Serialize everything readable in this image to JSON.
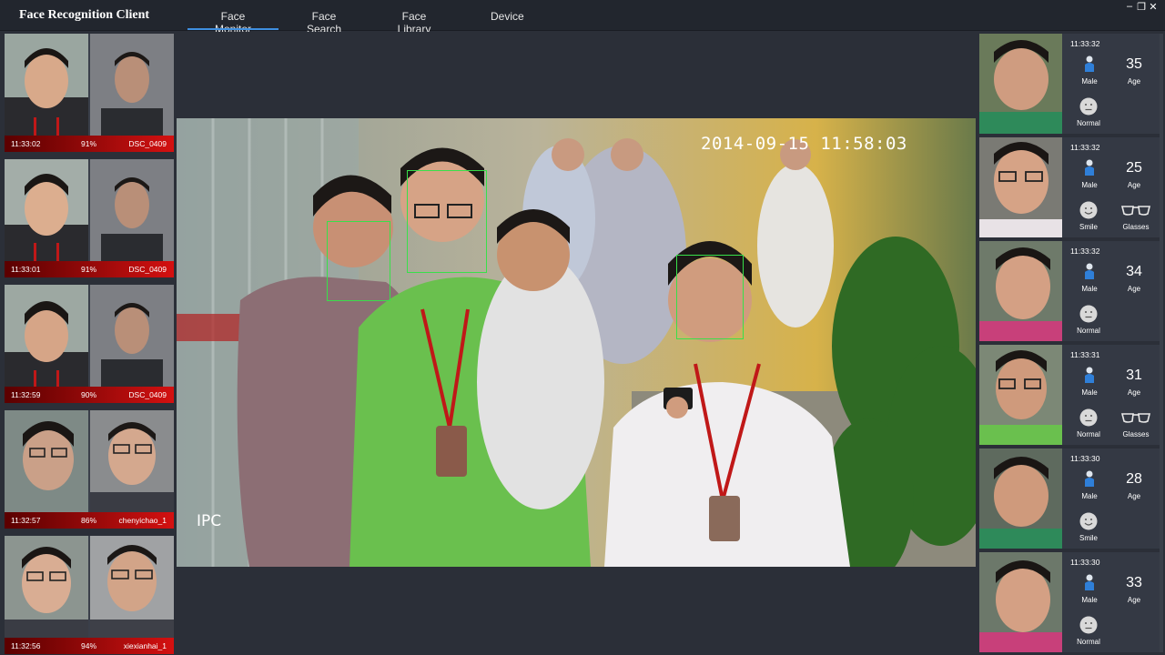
{
  "app": {
    "title": "Face Recognition Client"
  },
  "tabs": [
    {
      "label": "Face Monitor",
      "active": true
    },
    {
      "label": "Face Search",
      "active": false
    },
    {
      "label": "Face Library",
      "active": false
    },
    {
      "label": "Device",
      "active": false
    }
  ],
  "window_controls": {
    "minimize": "–",
    "restore": "❐",
    "close": "✕"
  },
  "matches": [
    {
      "time": "11:33:02",
      "score": "91%",
      "score_fraction": 0.91,
      "name": "DSC_0409"
    },
    {
      "time": "11:33:01",
      "score": "91%",
      "score_fraction": 0.91,
      "name": "DSC_0409"
    },
    {
      "time": "11:32:59",
      "score": "90%",
      "score_fraction": 0.9,
      "name": "DSC_0409"
    },
    {
      "time": "11:32:57",
      "score": "86%",
      "score_fraction": 0.86,
      "name": "chenyichao_1"
    },
    {
      "time": "11:32:56",
      "score": "94%",
      "score_fraction": 0.94,
      "name": "xiexianhai_1"
    }
  ],
  "video": {
    "timestamp": "2014-09-15 11:58:03",
    "camera_label": "IPC"
  },
  "detections": [
    {
      "time": "11:33:32",
      "gender": "Male",
      "age": "35",
      "age_label": "Age",
      "expression": "Normal",
      "glasses": ""
    },
    {
      "time": "11:33:32",
      "gender": "Male",
      "age": "25",
      "age_label": "Age",
      "expression": "Smile",
      "glasses": "Glasses"
    },
    {
      "time": "11:33:32",
      "gender": "Male",
      "age": "34",
      "age_label": "Age",
      "expression": "Normal",
      "glasses": ""
    },
    {
      "time": "11:33:31",
      "gender": "Male",
      "age": "31",
      "age_label": "Age",
      "expression": "Normal",
      "glasses": "Glasses"
    },
    {
      "time": "11:33:30",
      "gender": "Male",
      "age": "28",
      "age_label": "Age",
      "expression": "Smile",
      "glasses": ""
    },
    {
      "time": "11:33:30",
      "gender": "Male",
      "age": "33",
      "age_label": "Age",
      "expression": "Normal",
      "glasses": ""
    }
  ],
  "colors": {
    "accent": "#3f8fe0",
    "match_bar": "#d41010",
    "face_box": "#38e04a",
    "background": "#2b2f38"
  }
}
